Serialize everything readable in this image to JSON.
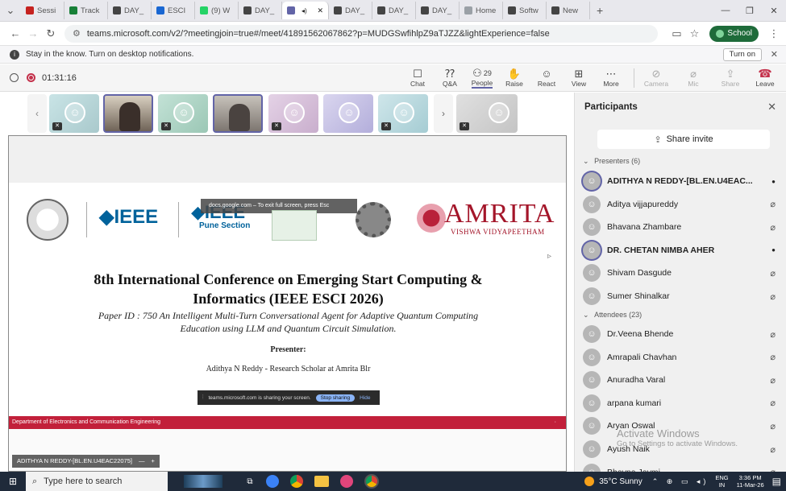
{
  "tabs": [
    {
      "label": "Sessi",
      "color": "#c5221f"
    },
    {
      "label": "Track",
      "color": "#188038"
    },
    {
      "label": "DAY_",
      "color": "#444"
    },
    {
      "label": "ESCI",
      "color": "#1967d2"
    },
    {
      "label": "(9) W",
      "color": "#25d366"
    },
    {
      "label": "DAY_",
      "color": "#444"
    },
    {
      "label": "",
      "color": "#6264a7"
    },
    {
      "label": "DAY_",
      "color": "#444"
    },
    {
      "label": "DAY_",
      "color": "#444"
    },
    {
      "label": "DAY_",
      "color": "#444"
    },
    {
      "label": "Home",
      "color": "#9aa0a6"
    },
    {
      "label": "Softw",
      "color": "#444"
    },
    {
      "label": "New",
      "color": "#444"
    }
  ],
  "address": {
    "url": "teams.microsoft.com/v2/?meetingjoin=true#/meet/41891562067862?p=MUDGSwfihlpZ9aTJZZ&lightExperience=false",
    "profile": "School"
  },
  "notification": {
    "text": "Stay in the know. Turn on desktop notifications.",
    "button": "Turn on"
  },
  "meeting": {
    "timer": "01:31:16",
    "people_count": "29",
    "toolbar": [
      {
        "label": "Chat",
        "icon": "chat-icon",
        "glyph": "☐"
      },
      {
        "label": "Q&A",
        "icon": "qa-icon",
        "glyph": "⁇"
      },
      {
        "label": "People",
        "icon": "people-icon",
        "glyph": "⚇"
      },
      {
        "label": "Raise",
        "icon": "raise-hand-icon",
        "glyph": "✋"
      },
      {
        "label": "React",
        "icon": "react-icon",
        "glyph": "☺"
      },
      {
        "label": "View",
        "icon": "view-icon",
        "glyph": "⊞"
      },
      {
        "label": "More",
        "icon": "more-icon",
        "glyph": "⋯"
      }
    ],
    "devices": [
      {
        "label": "Camera",
        "icon": "camera-off-icon",
        "glyph": "⊘"
      },
      {
        "label": "Mic",
        "icon": "mic-off-icon",
        "glyph": "⌀"
      },
      {
        "label": "Share",
        "icon": "share-icon",
        "glyph": "⇪"
      }
    ],
    "leave": "Leave"
  },
  "slide": {
    "logo_ieee": "◆IEEE",
    "logo_ieee_pune": "◆IEEE",
    "pune_section": "Pune Section",
    "amrita": "AMRITA",
    "amrita_sub": "VISHWA VIDYAPEETHAM",
    "fullscreen_tip": "docs.google.com – To exit full screen, press Esc",
    "title_line1": "8th International Conference on Emerging Start Computing &",
    "title_line2": "Informatics (IEEE ESCI 2026)",
    "paper_line1": "Paper ID : 750 An Intelligent Multi-Turn Conversational Agent for Adaptive Quantum Computing",
    "paper_line2": "Education using LLM and Quantum Circuit Simulation.",
    "presenter_label": "Presenter:",
    "presenter_name": "Adithya N Reddy - Research Scholar at Amrita Blr",
    "sharing_text": "teams.microsoft.com is sharing your screen.",
    "stop_sharing": "Stop sharing",
    "hide": "Hide",
    "footer": "Department of Electronics and Communication Engineering"
  },
  "stage_label": "ADITHYA N REDDY-[BL.EN.U4EAC22075]",
  "panel": {
    "title": "Participants",
    "share_invite": "Share invite",
    "presenters_header": "Presenters (6)",
    "presenters": [
      {
        "name": "ADITHYA N REDDY-[BL.EN.U4EAC...",
        "bold": true,
        "ring": true,
        "state": "mic-on"
      },
      {
        "name": "Aditya vijjapureddy",
        "bold": false,
        "ring": false,
        "state": "mic-off"
      },
      {
        "name": "Bhavana Zhambare",
        "bold": false,
        "ring": false,
        "state": "mic-off"
      },
      {
        "name": "DR. CHETAN NIMBA AHER",
        "bold": true,
        "ring": true,
        "state": "mic-on"
      },
      {
        "name": "Shivam Dasgude",
        "bold": false,
        "ring": false,
        "state": "mic-off"
      },
      {
        "name": "Sumer Shinalkar",
        "bold": false,
        "ring": false,
        "state": "mic-off"
      }
    ],
    "attendees_header": "Attendees (23)",
    "attendees": [
      {
        "name": "Dr.Veena Bhende",
        "state": "mic-off"
      },
      {
        "name": "Amrapali Chavhan",
        "state": "mic-off"
      },
      {
        "name": "Anuradha Varal",
        "state": "mic-off"
      },
      {
        "name": "arpana kumari",
        "state": "mic-off"
      },
      {
        "name": "Aryan Oswal",
        "state": "mic-off"
      },
      {
        "name": "Ayush Naik",
        "state": "mic-off"
      },
      {
        "name": "Bhavna Jaymi",
        "state": "mic-off"
      }
    ],
    "activate_line1": "Activate Windows",
    "activate_line2": "Go to Settings to activate Windows."
  },
  "taskbar": {
    "search": "Type here to search",
    "weather": "35°C  Sunny",
    "lang1": "ENG",
    "lang2": "IN",
    "time": "3:36 PM",
    "date": "11-Mar-26"
  }
}
